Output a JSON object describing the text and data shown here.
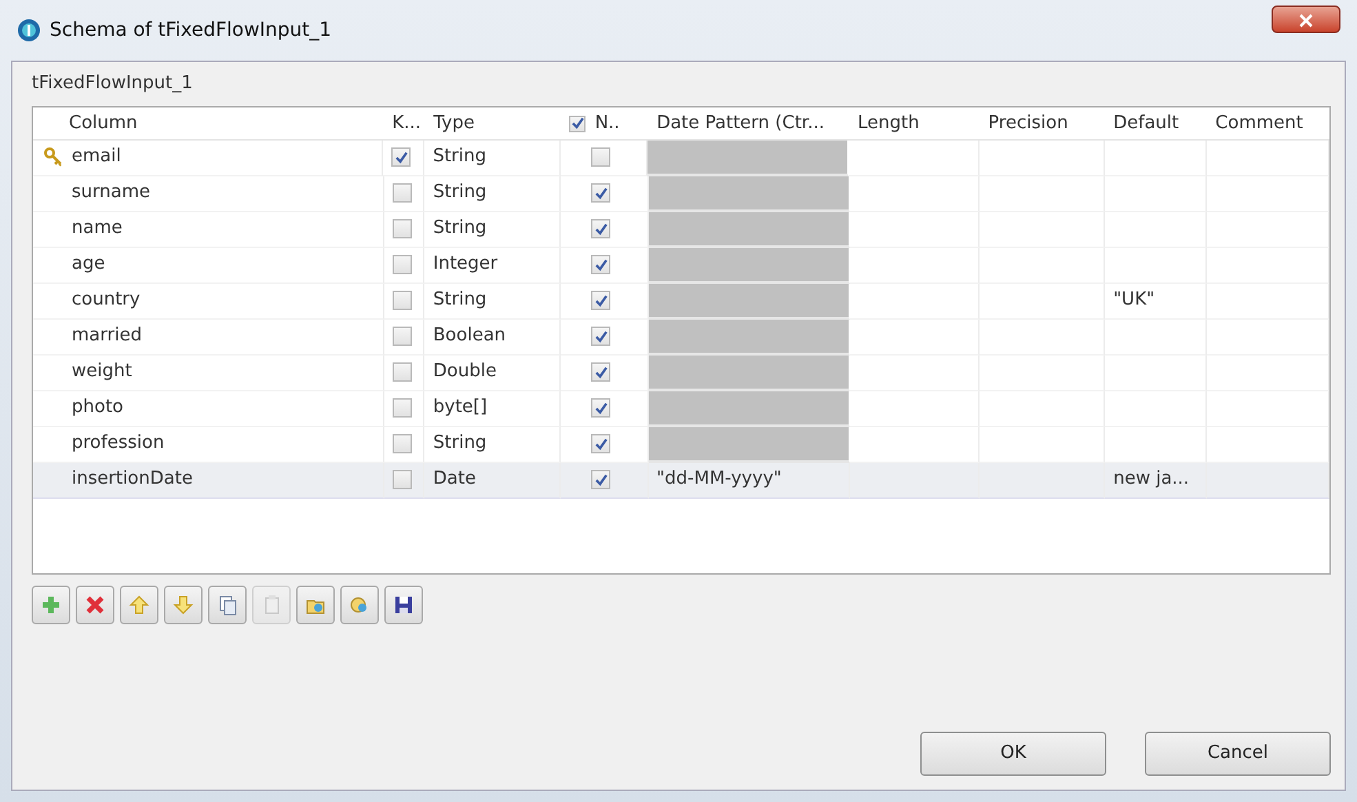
{
  "window": {
    "title": "Schema of tFixedFlowInput_1"
  },
  "component_label": "tFixedFlowInput_1",
  "table": {
    "columns": [
      {
        "kind": "text",
        "label": "Column"
      },
      {
        "kind": "text",
        "label": "K..."
      },
      {
        "kind": "text",
        "label": "Type"
      },
      {
        "kind": "checkbox",
        "label": "N..",
        "checked": true
      },
      {
        "kind": "text",
        "label": "Date Pattern (Ctr..."
      },
      {
        "kind": "text",
        "label": "Length"
      },
      {
        "kind": "text",
        "label": "Precision"
      },
      {
        "kind": "text",
        "label": "Default"
      },
      {
        "kind": "text",
        "label": "Comment"
      }
    ],
    "rows": [
      {
        "column": "email",
        "key": true,
        "type": "String",
        "nullable": false,
        "pattern_editable": false,
        "selected": false
      },
      {
        "column": "surname",
        "key": false,
        "type": "String",
        "nullable": true,
        "pattern_editable": false,
        "selected": false
      },
      {
        "column": "name",
        "key": false,
        "type": "String",
        "nullable": true,
        "pattern_editable": false,
        "selected": false
      },
      {
        "column": "age",
        "key": false,
        "type": "Integer",
        "nullable": true,
        "pattern_editable": false,
        "selected": false
      },
      {
        "column": "country",
        "key": false,
        "type": "String",
        "nullable": true,
        "pattern_editable": false,
        "default": "\"UK\"",
        "selected": false
      },
      {
        "column": "married",
        "key": false,
        "type": "Boolean",
        "nullable": true,
        "pattern_editable": false,
        "selected": false
      },
      {
        "column": "weight",
        "key": false,
        "type": "Double",
        "nullable": true,
        "pattern_editable": false,
        "selected": false
      },
      {
        "column": "photo",
        "key": false,
        "type": "byte[]",
        "nullable": true,
        "pattern_editable": false,
        "selected": false
      },
      {
        "column": "profession",
        "key": false,
        "type": "String",
        "nullable": true,
        "pattern_editable": false,
        "selected": false
      },
      {
        "column": "insertionDate",
        "key": false,
        "type": "Date",
        "nullable": true,
        "pattern_editable": true,
        "date_pattern": "\"dd-MM-yyyy\"",
        "default": "new ja...",
        "selected": true
      }
    ]
  },
  "toolbar": [
    {
      "kind": "add",
      "disabled": false
    },
    {
      "kind": "remove",
      "disabled": false
    },
    {
      "kind": "up",
      "disabled": false
    },
    {
      "kind": "down",
      "disabled": false
    },
    {
      "kind": "copy",
      "disabled": false
    },
    {
      "kind": "paste",
      "disabled": true
    },
    {
      "kind": "import",
      "disabled": false
    },
    {
      "kind": "export",
      "disabled": false
    },
    {
      "kind": "save",
      "disabled": false
    }
  ],
  "buttons": [
    {
      "label": "OK"
    },
    {
      "label": "Cancel"
    }
  ]
}
